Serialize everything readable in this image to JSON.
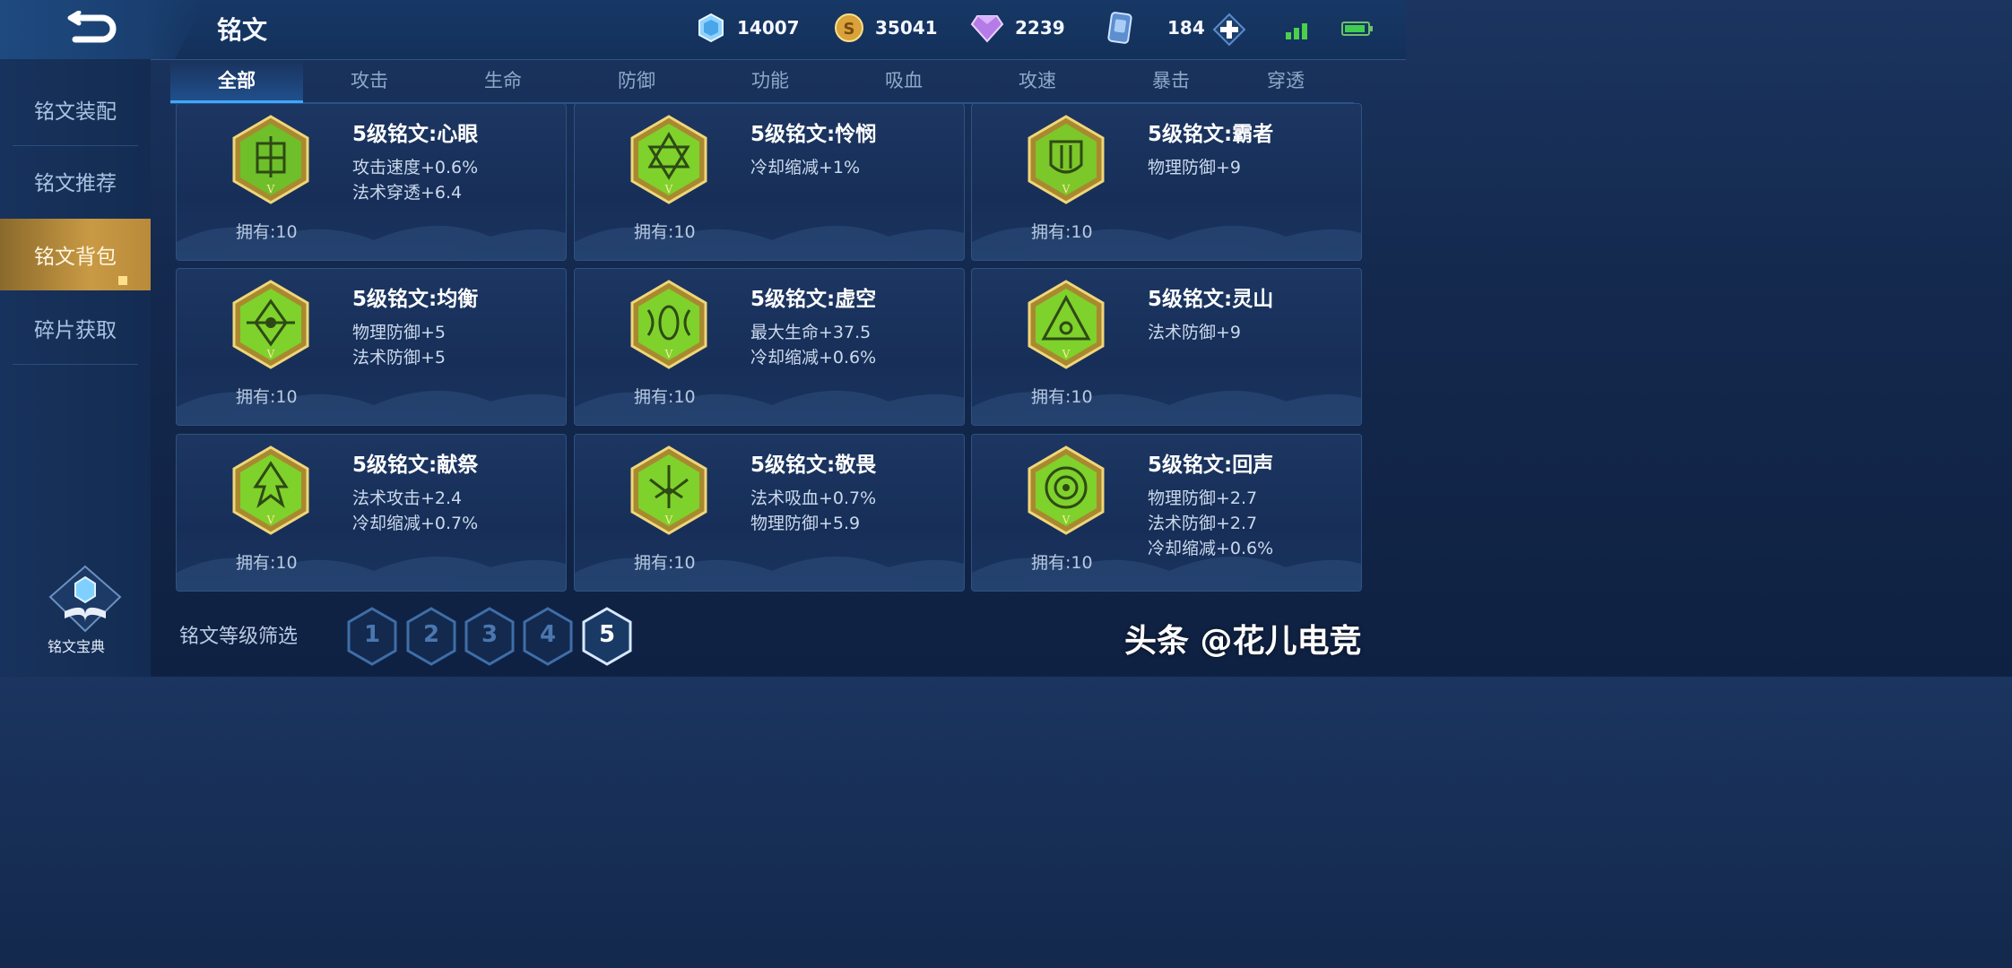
{
  "header": {
    "title": "铭文",
    "resources": [
      {
        "icon": "crystal-icon",
        "value": "14007"
      },
      {
        "icon": "gold-coin-icon",
        "value": "35041"
      },
      {
        "icon": "diamond-icon",
        "value": "2239"
      },
      {
        "icon": "voucher-icon",
        "value": "184"
      }
    ]
  },
  "sidebar": {
    "items": [
      {
        "label": "铭文装配"
      },
      {
        "label": "铭文推荐"
      },
      {
        "label": "铭文背包"
      },
      {
        "label": "碎片获取"
      }
    ],
    "active_index": 2,
    "codex_label": "铭文宝典"
  },
  "tabs": [
    {
      "label": "全部"
    },
    {
      "label": "攻击"
    },
    {
      "label": "生命"
    },
    {
      "label": "防御"
    },
    {
      "label": "功能"
    },
    {
      "label": "吸血"
    },
    {
      "label": "攻速"
    },
    {
      "label": "暴击"
    },
    {
      "label": "穿透"
    }
  ],
  "cards": [
    {
      "name": "5级铭文:心眼",
      "stats": [
        "攻击速度+0.6%",
        "法术穿透+6.4"
      ],
      "owned": "拥有:10",
      "emblem": "xinyan"
    },
    {
      "name": "5级铭文:怜悯",
      "stats": [
        "冷却缩减+1%"
      ],
      "owned": "拥有:10",
      "emblem": "lianmin"
    },
    {
      "name": "5级铭文:霸者",
      "stats": [
        "物理防御+9"
      ],
      "owned": "拥有:10",
      "emblem": "bazhe"
    },
    {
      "name": "5级铭文:均衡",
      "stats": [
        "物理防御+5",
        "法术防御+5"
      ],
      "owned": "拥有:10",
      "emblem": "junheng"
    },
    {
      "name": "5级铭文:虚空",
      "stats": [
        "最大生命+37.5",
        "冷却缩减+0.6%"
      ],
      "owned": "拥有:10",
      "emblem": "xukong"
    },
    {
      "name": "5级铭文:灵山",
      "stats": [
        "法术防御+9"
      ],
      "owned": "拥有:10",
      "emblem": "lingshan"
    },
    {
      "name": "5级铭文:献祭",
      "stats": [
        "法术攻击+2.4",
        "冷却缩减+0.7%"
      ],
      "owned": "拥有:10",
      "emblem": "xianji"
    },
    {
      "name": "5级铭文:敬畏",
      "stats": [
        "法术吸血+0.7%",
        "物理防御+5.9"
      ],
      "owned": "拥有:10",
      "emblem": "jingwei"
    },
    {
      "name": "5级铭文:回声",
      "stats": [
        "物理防御+2.7",
        "法术防御+2.7",
        "冷却缩减+0.6%"
      ],
      "owned": "拥有:10",
      "emblem": "huisheng"
    }
  ],
  "level_filter": {
    "label": "铭文等级筛选",
    "levels": [
      "1",
      "2",
      "3",
      "4",
      "5"
    ],
    "selected": "5"
  },
  "watermark": "头条 @花儿电竞",
  "colors": {
    "accent_gold": "#c99a44",
    "emblem_green": "#7fd12c",
    "tab_active": "#3ea8ff"
  }
}
